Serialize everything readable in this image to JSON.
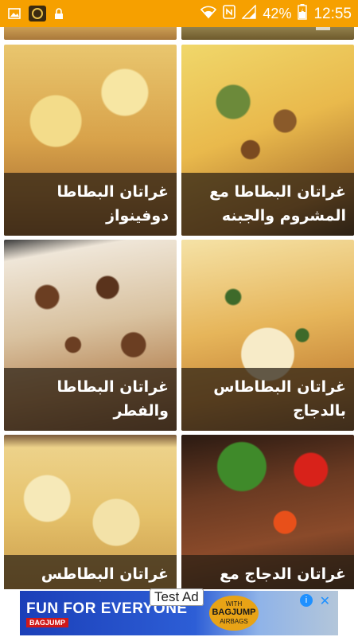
{
  "status_bar": {
    "battery_percent": "42%",
    "time": "12:55",
    "icons": [
      "image-icon",
      "app-icon",
      "lock-icon",
      "wifi-icon",
      "nfc-icon",
      "signal-icon",
      "battery-icon"
    ],
    "color": "#F6A000"
  },
  "recipes": [
    {
      "title": "غراتان البطاطا مع المشروم والجبنه"
    },
    {
      "title": "غراتان البطاطا دوفينواز"
    },
    {
      "title": "غراتان البطاطاس بالدجاج"
    },
    {
      "title": "غراتان البطاطا والفطر"
    },
    {
      "title": "غراتان الدجاج مع"
    },
    {
      "title": "غراتان البطاطس"
    }
  ],
  "ad": {
    "label": "Test Ad",
    "headline": "FUN FOR EVERYONE",
    "brand": "BAGJUMP",
    "badge_line1": "WITH",
    "badge_line2": "BAGJUMP",
    "badge_line3": "AIRBAGS"
  }
}
